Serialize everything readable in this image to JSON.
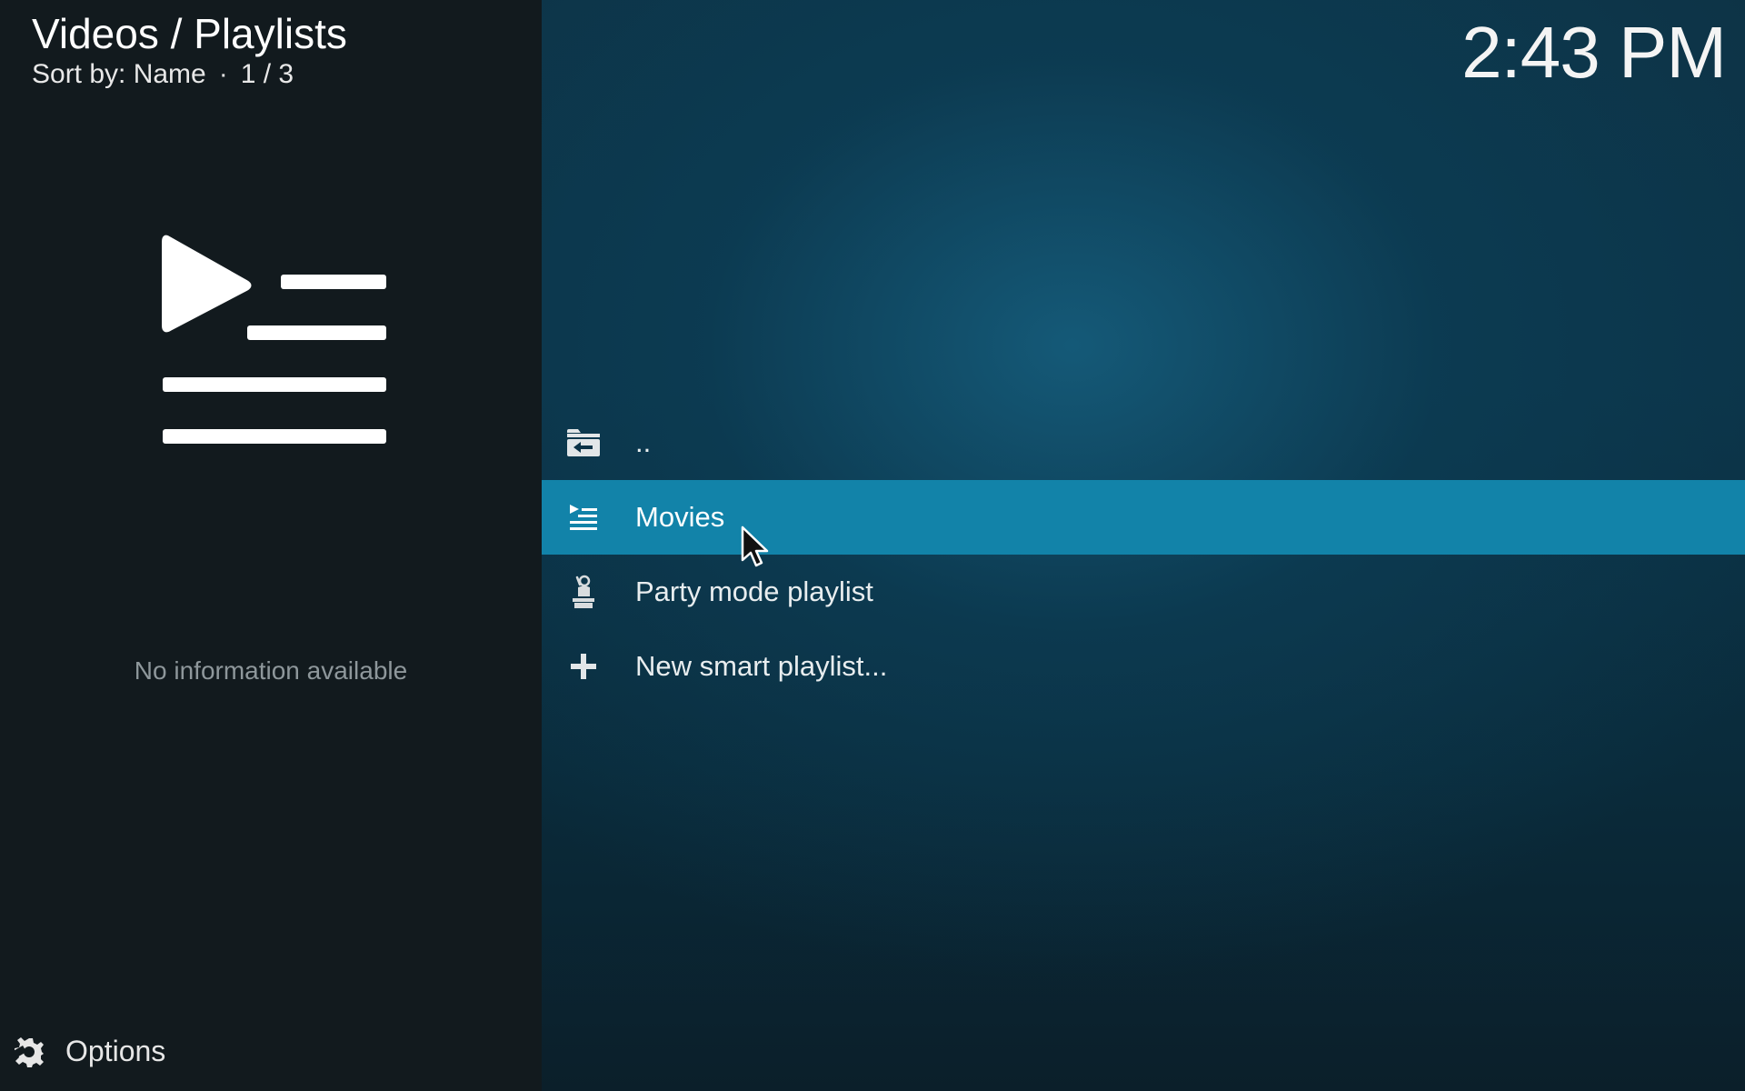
{
  "header": {
    "breadcrumb": "Videos / Playlists",
    "sort_label": "Sort by: Name",
    "separator": "·",
    "position": "1 / 3"
  },
  "clock": "2:43 PM",
  "info_panel": {
    "no_info_text": "No information available"
  },
  "options": {
    "label": "Options",
    "icon": "gear-icon"
  },
  "list": {
    "items": [
      {
        "label": "..",
        "icon": "folder-back-icon"
      },
      {
        "label": "Movies",
        "icon": "playlist-icon",
        "focused": true
      },
      {
        "label": "Party mode playlist",
        "icon": "party-mode-icon"
      },
      {
        "label": "New smart playlist...",
        "icon": "plus-icon"
      }
    ]
  },
  "colors": {
    "focus_accent": "#1283a9",
    "side_panel": "#121a1e",
    "background": "#0c3347"
  }
}
